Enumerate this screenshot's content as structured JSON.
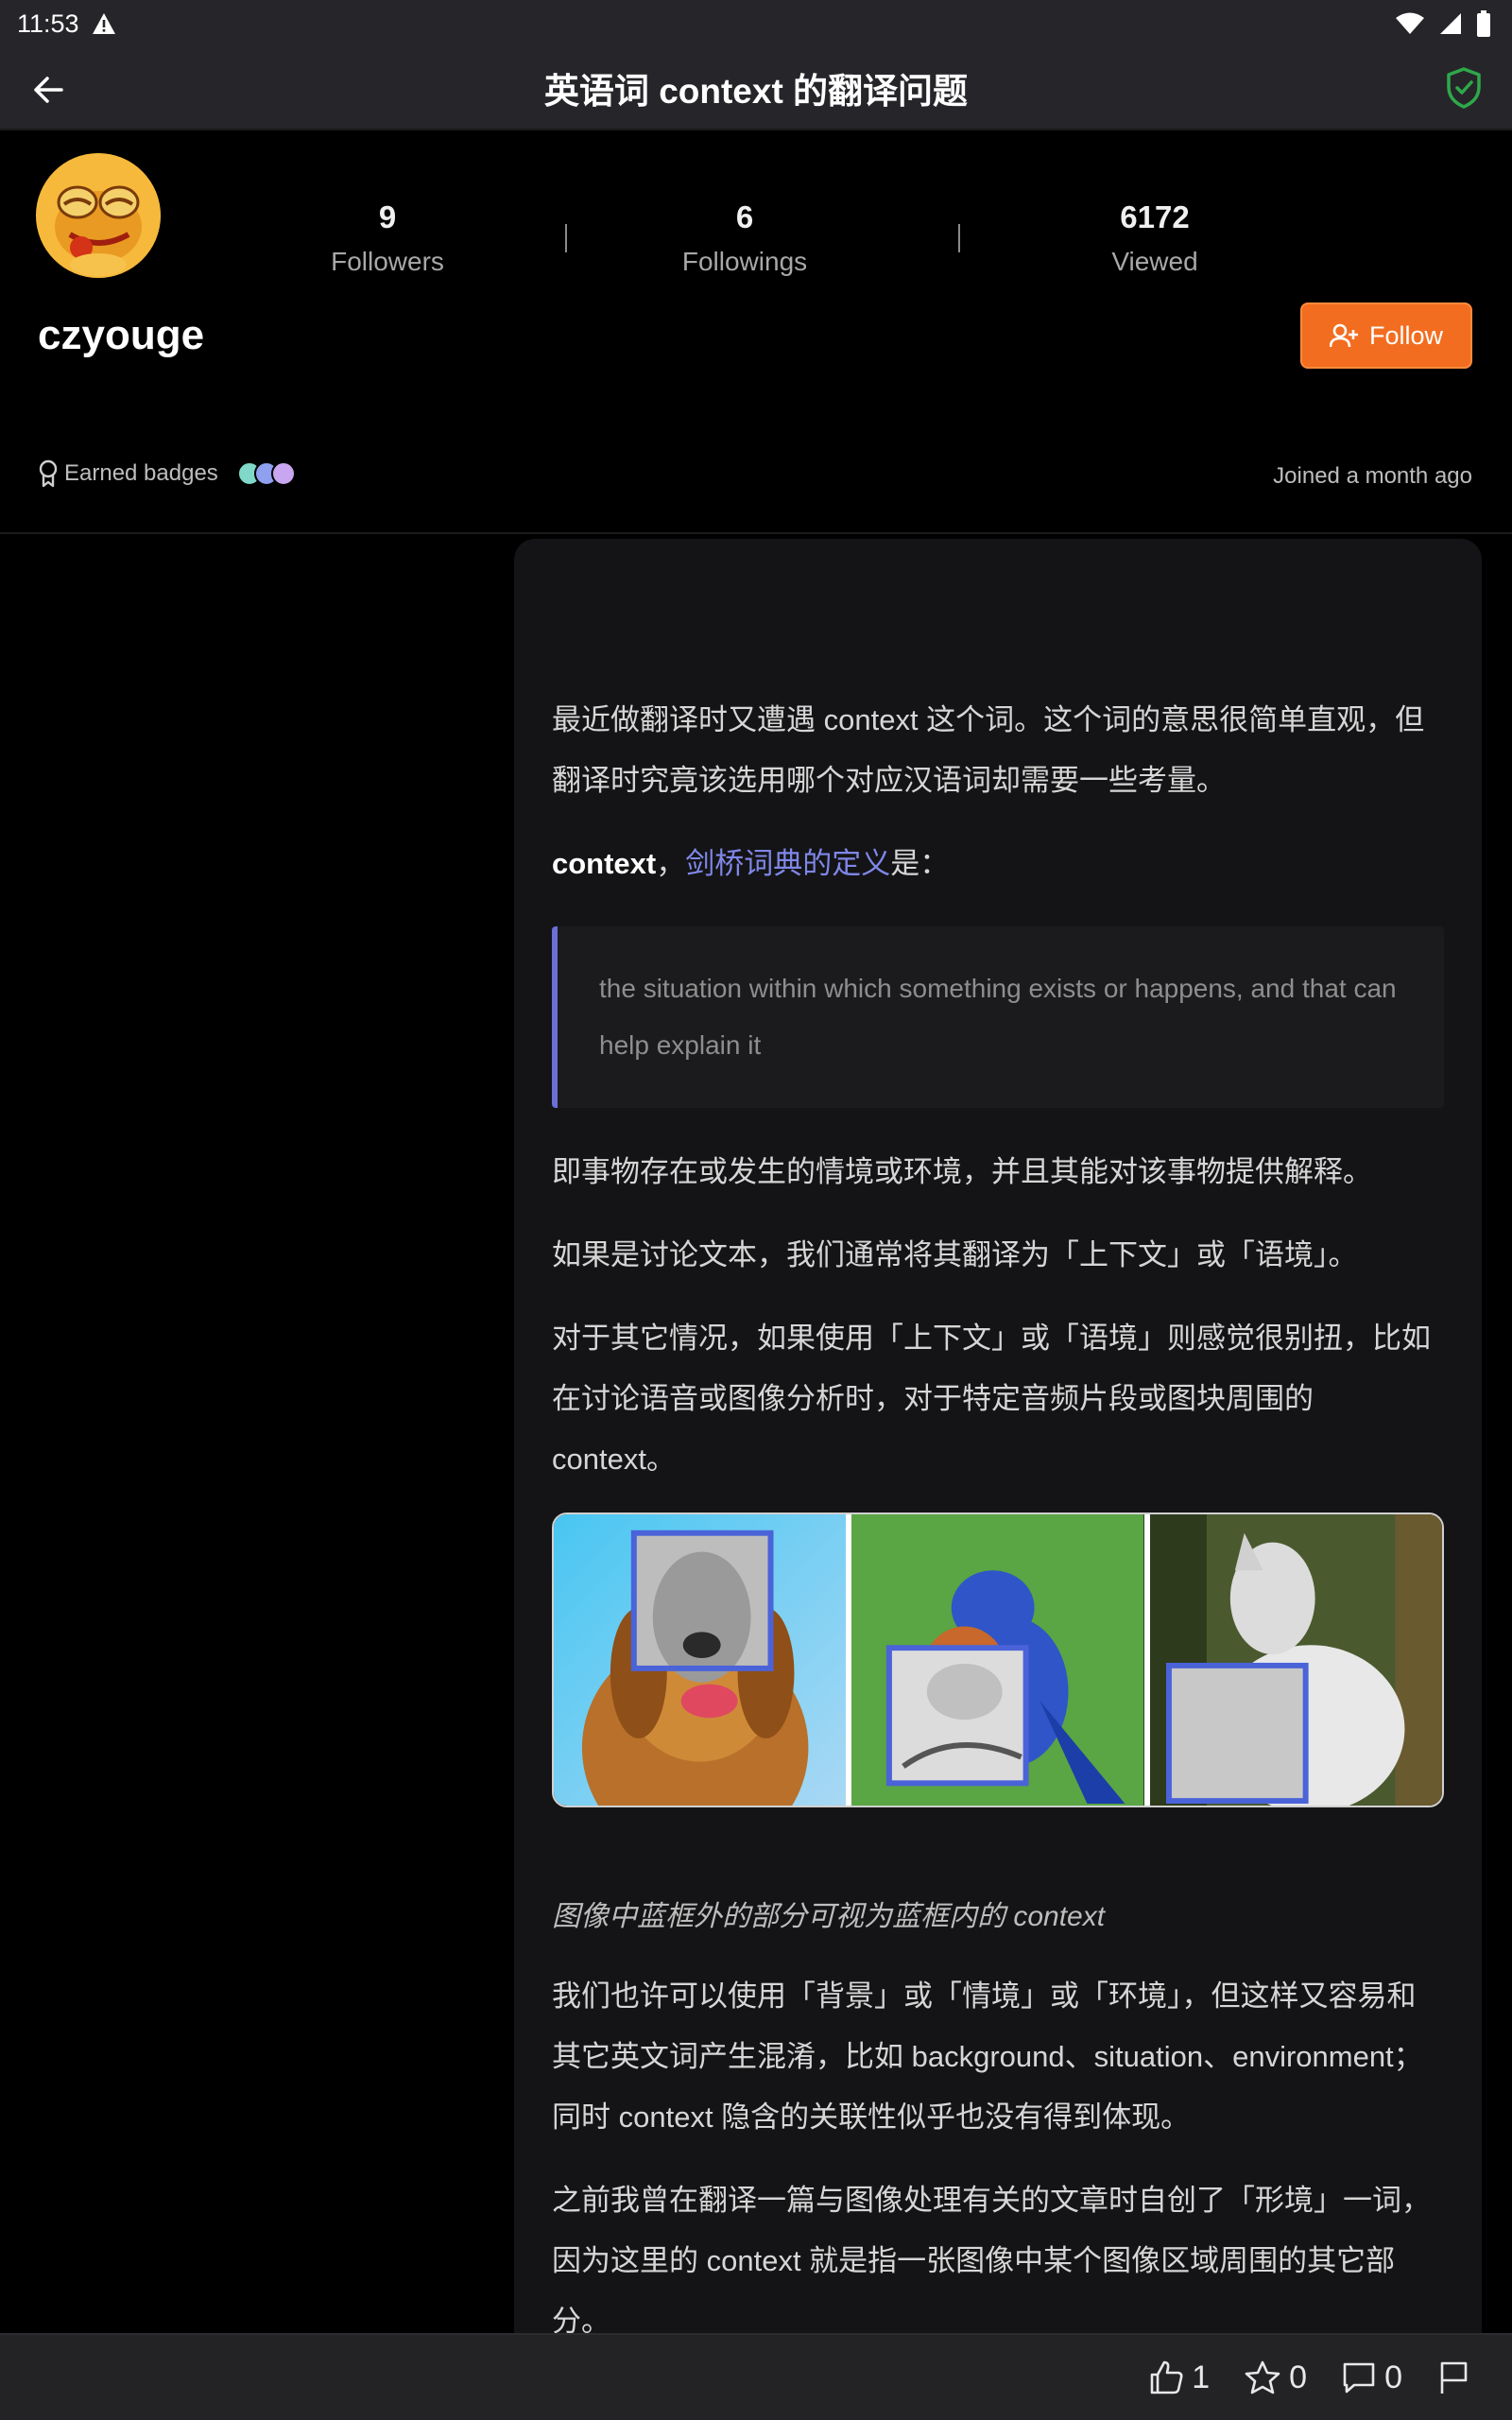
{
  "status_bar": {
    "time": "11:53",
    "icons": [
      "warning-icon",
      "wifi-icon",
      "cellular-icon",
      "battery-icon"
    ]
  },
  "app_bar": {
    "title": "英语词 context 的翻译问题",
    "back_icon": "arrow-left-icon",
    "shield_icon": "shield-check-icon",
    "shield_color": "#2ea84a"
  },
  "profile": {
    "username": "czyouge",
    "stats": [
      {
        "value": "9",
        "label": "Followers"
      },
      {
        "value": "6",
        "label": "Followings"
      },
      {
        "value": "6172",
        "label": "Viewed"
      }
    ],
    "follow_label": "Follow",
    "earned_badges_label": "Earned badges",
    "joined_text": "Joined a month ago",
    "accent": "#f26d1f"
  },
  "article": {
    "p1": "最近做翻译时又遭遇 context 这个词。这个词的意思很简单直观，但翻译时究竟该选用哪个对应汉语词却需要一些考量。",
    "p2_term": "context",
    "p2_sep": "，",
    "p2_link": "剑桥词典的定义",
    "p2_tail": "是：",
    "quote": "the situation within which something exists or happens, and that can help explain it",
    "p3": "即事物存在或发生的情境或环境，并且其能对该事物提供解释。",
    "p4": "如果是讨论文本，我们通常将其翻译为「上下文」或「语境」。",
    "p5": "对于其它情况，如果使用「上下文」或「语境」则感觉很别扭，比如在讨论语音或图像分析时，对于特定音频片段或图块周围的 context。",
    "caption": "图像中蓝框外的部分可视为蓝框内的 context",
    "p6": "我们也许可以使用「背景」或「情境」或「环境」，但这样又容易和其它英文词产生混淆，比如 background、situation、environment；同时 context 隐含的关联性似乎也没有得到体现。",
    "p7": "之前我曾在翻译一篇与图像处理有关的文章时自创了「形境」一词，因为这里的 context 就是指一张图像中某个图像区域周围的其它部分。",
    "link_color": "#7f87e8",
    "figure_panels": [
      "dog-image",
      "bird-image",
      "wolf-image"
    ]
  },
  "bottom_bar": {
    "like_count": "1",
    "star_count": "0",
    "comment_count": "0",
    "icons": [
      "thumbs-up-icon",
      "star-icon",
      "comment-icon",
      "flag-icon"
    ]
  }
}
